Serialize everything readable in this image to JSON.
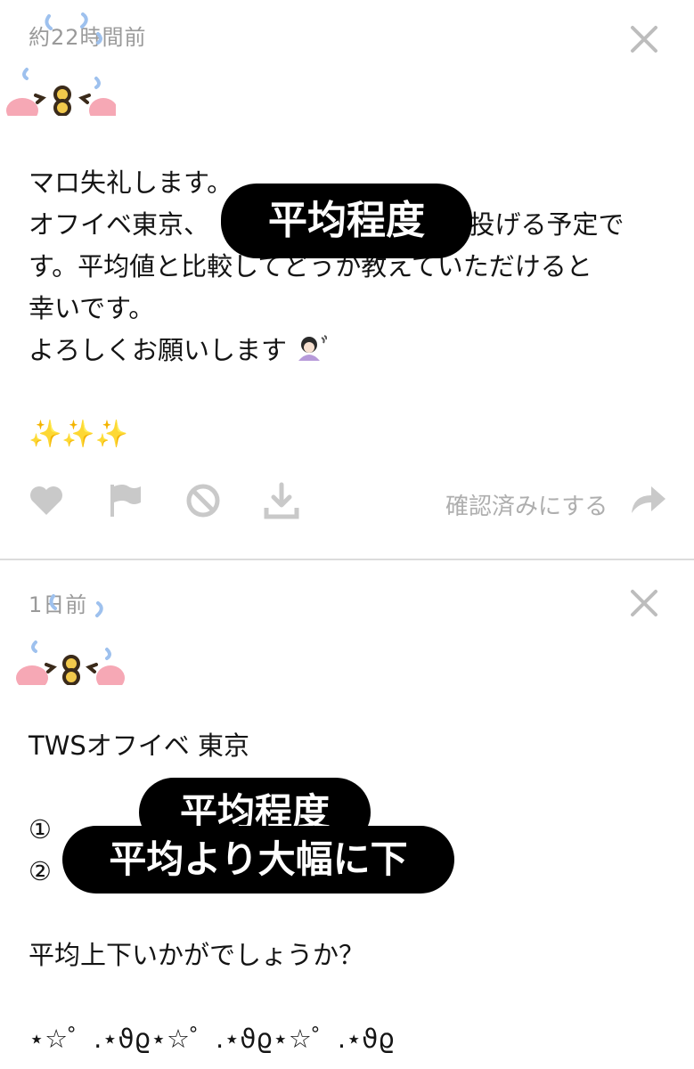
{
  "posts": [
    {
      "timestamp": "約22時間前",
      "lines": [
        "マロ失礼します。",
        "オフイベ東京、",
        "枚投げる予定で",
        "す。平均値と比較してどうか教えていただけると",
        "幸いです。",
        "よろしくお願いします"
      ],
      "sparkles": "✨✨✨",
      "confirm_label": "確認済みにする"
    },
    {
      "timestamp": "1日前",
      "lines": [
        "TWSオフイベ 東京",
        "①",
        "②",
        "平均上下いかがでしょうか？",
        "⋆☆゜.⋆ϑϱ⋆☆゜.⋆ϑϱ⋆☆゜.⋆ϑϱ"
      ]
    }
  ],
  "overlays": {
    "top": "平均程度",
    "bottom_1": "平均程度",
    "bottom_2": "平均より大幅に下"
  },
  "icons": {
    "close": "close-icon",
    "like": "heart-icon",
    "report": "flag-icon",
    "block": "block-icon",
    "download": "download-icon",
    "forward": "forward-arrow-icon",
    "avatar": "kanahei-usagi-face-icon"
  },
  "colors": {
    "icon_gray": "#c9c9c9",
    "timestamp_gray": "#9a9a9a",
    "sparkle": "#f6c21c",
    "cheek_pink": "#f6a8b5"
  }
}
